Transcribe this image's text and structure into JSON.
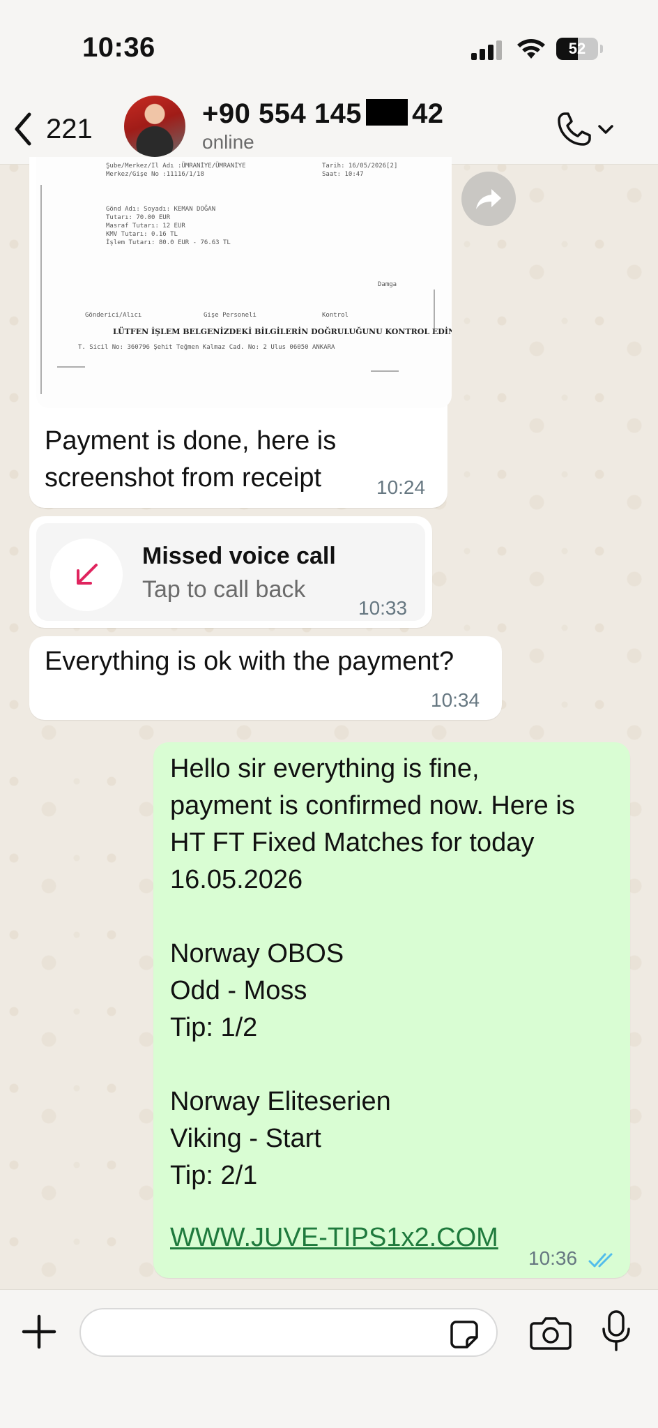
{
  "status_bar": {
    "time": "10:36",
    "battery": "52",
    "battery_level": 0.52
  },
  "header": {
    "back_count": "221",
    "contact_prefix": "+90 554 145",
    "contact_suffix": "42",
    "status": "online"
  },
  "messages": {
    "receipt": {
      "caption": "Payment is done, here is\nscreenshot from receipt",
      "time": "10:24",
      "doc_lines": [
        "Şube/Merkez/Il Adı :ÜMRANİYE/ÜMRANİYE",
        "Merkez/Gişe No      :11116/1/18",
        "Tarih: 16/05/2026[2]",
        "Saat: 10:47",
        "Gönd Adı: Soyadı: KEMAN DOĞAN",
        "Tutarı: 70.00 EUR",
        "Masraf Tutarı: 12 EUR",
        "KMV Tutarı: 0.16 TL",
        "İşlem Tutarı: 80.0 EUR  -  76.63 TL",
        "Damga",
        "Gönderici/Alıcı",
        "Gişe Personeli",
        "Kontrol",
        "LÜTFEN İŞLEM BELGENİZDEKİ BİLGİLERİN DOĞRULUĞUNU KONTROL EDİNİZ.",
        "T. Sicil No: 360796  Şehit Teğmen Kalmaz Cad. No: 2  Ulus 06050  ANKARA"
      ]
    },
    "missed_call": {
      "title": "Missed voice call",
      "subtitle": "Tap to call back",
      "time": "10:33"
    },
    "question": {
      "text": "Everything is ok with the payment?",
      "time": "10:34"
    },
    "reply": {
      "text": "Hello sir everything is fine,\npayment is confirmed now. Here is\nHT FT Fixed Matches for today\n16.05.2026\n\nNorway OBOS\nOdd - Moss\nTip: 1/2\n\nNorway Eliteserien\nViking - Start\nTip: 2/1\n",
      "link": "WWW.JUVE-TIPS1x2.COM",
      "time": "10:36"
    }
  },
  "colors": {
    "outgoing": "#d9fdd3",
    "incoming": "#ffffff",
    "missed_red": "#e0245e",
    "read_tick": "#53bdeb"
  },
  "icons": [
    "back-chevron-icon",
    "phone-icon",
    "chevron-down-icon",
    "forward-icon",
    "missed-call-icon",
    "double-check-icon",
    "plus-icon",
    "sticker-icon",
    "camera-icon",
    "mic-icon"
  ]
}
